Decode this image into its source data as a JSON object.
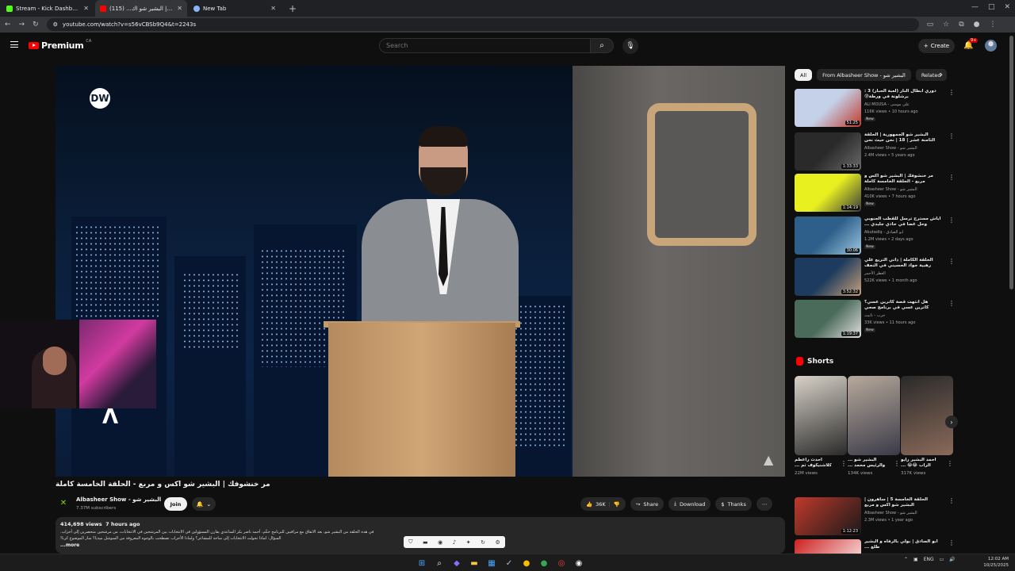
{
  "browser": {
    "tabs": [
      {
        "title": "Stream - Kick Dashboard",
        "color": "#53fc18"
      },
      {
        "title": "مر خنشوفك | البشير شو اك... (115)",
        "color": "#ff0000"
      },
      {
        "title": "New Tab",
        "color": "#8ab4f8"
      }
    ],
    "url": "youtube.com/watch?v=s56vCBSb9Q4&t=2243s"
  },
  "header": {
    "logo_text": "Premium",
    "region": "CA",
    "search_placeholder": "Search",
    "create_label": "Create",
    "notif_count": "9+"
  },
  "video": {
    "title": "مر خنشوفك | البشير شو اكس و مربع - الحلقة الخامسة كاملة",
    "channel": "Albasheer Show - البشير شو",
    "subscribers": "7.37M subscribers",
    "join_label": "Join",
    "likes": "36K",
    "share_label": "Share",
    "download_label": "Download",
    "thanks_label": "Thanks",
    "views": "414,698 views",
    "age": "7 hours ago",
    "desc_line1": "في هذه الحلقة من البشير شو، بعد الاتفاق مع مراقبين للبرنامج حكَم، أحمد ناصر بكر الساعدي يقارن المسؤولين في الانتخابات بين المرشحين في الانتخابات، من مرشحين منحصرين إلى أحزاب.",
    "desc_line2": "السؤال: لماذا تحولت الانتخابات إلى ساحة للمشاعر؟ ولماذا الأحزاب تصطحب بالوجوه المعروفة من السوشل ميديا؟ سار الموضوع كرنا!",
    "more_label": "...more",
    "overlay_logo": "DW"
  },
  "chips": [
    "All",
    "From Albasheer Show - البشير شو",
    "Related"
  ],
  "recommendations": [
    {
      "title": "دوري ابطال النار (لعبة الحبار) 3 : برشلونة في ورطة😰",
      "channel": "ALI MOUSA - علي موسى",
      "views": "116K views",
      "age": "10 hours ago",
      "duration": "51:25",
      "new": "New",
      "c1": "#c4d1e8",
      "c2": "#c0392b"
    },
    {
      "title": "البشير شو الجمهورية | الحلقة الثامنة عشر | 18 | نحن حيث نحن",
      "channel": "Albasheer Show - البشير شو",
      "views": "2.4M views",
      "age": "5 years ago",
      "duration": "1:33:33",
      "new": "",
      "c1": "#2a2a2a",
      "c2": "#6a6a6a"
    },
    {
      "title": "مر خنشوفك | البشير شو اكس و مربع - الحلقة الخامسة كاملة",
      "channel": "Albasheer Show - البشير شو",
      "views": "410K views",
      "age": "7 hours ago",
      "duration": "1:14:19",
      "new": "New",
      "c1": "#e8f020",
      "c2": "#3a3a3a"
    },
    {
      "title": "أياش مسترح ترسل للقطب الجنوبي وحل غضا في حادي جليدي ... حقيقة اللي خايف يواجهها",
      "channel": "Abutadiq - ابو الصادق",
      "views": "1.2M views",
      "age": "2 days ago",
      "duration": "30:06",
      "new": "New",
      "c1": "#2d5f8a",
      "c2": "#9ec7e0"
    },
    {
      "title": "الحلقة الكاملة | ذاتي التريع علي رهبية جواد الحسيني في النجف وعطايا المعارضة العراقية",
      "channel": "العطر الأحمر",
      "views": "522K views",
      "age": "1 month ago",
      "duration": "3:52:32",
      "new": "",
      "c1": "#1d3b5e",
      "c2": "#c9a27a"
    },
    {
      "title": "هل انتهت قصة كاترين عسي؟ كاترين عسي في برنامج صحي",
      "channel": "حرب - تانيث",
      "views": "33K views",
      "age": "11 hours ago",
      "duration": "1:19:37",
      "new": "New",
      "c1": "#4a6a5a",
      "c2": "#e0e0e0"
    }
  ],
  "shorts_label": "Shorts",
  "shorts": [
    {
      "title": "أحدث راعطم كلاشنيكوف ثم ...",
      "views": "22M views",
      "c1": "#d8d2c8",
      "c2": "#2a2a2a"
    },
    {
      "title": "البشير شو ... والرئيس محمد ...",
      "views": "134K views",
      "c1": "#b7a99b",
      "c2": "#3a3a48"
    },
    {
      "title": "احمد البشير رايو الراب 😂😂 ...",
      "views": "317K views",
      "c1": "#2a2a2a",
      "c2": "#8a6a5a"
    }
  ],
  "recommendations2": [
    {
      "title": "الحلقة الخامسة 5 | ساهرون | البشير شو اكس و مربع",
      "channel": "Albasheer Show - البشير شو",
      "views": "2.3M views",
      "age": "1 year ago",
      "duration": "1:12:23",
      "c1": "#c0392b",
      "c2": "#1a1a1a"
    },
    {
      "title": "ابو الصادق | بولي بالرفاه و البشير طلع ...",
      "channel": "",
      "views": "",
      "age": "",
      "duration": "",
      "c1": "#cc2020",
      "c2": "#ffffff"
    }
  ],
  "taskbar": {
    "lang": "ENG",
    "time": "12:02 AM",
    "date": "10/25/2025"
  }
}
